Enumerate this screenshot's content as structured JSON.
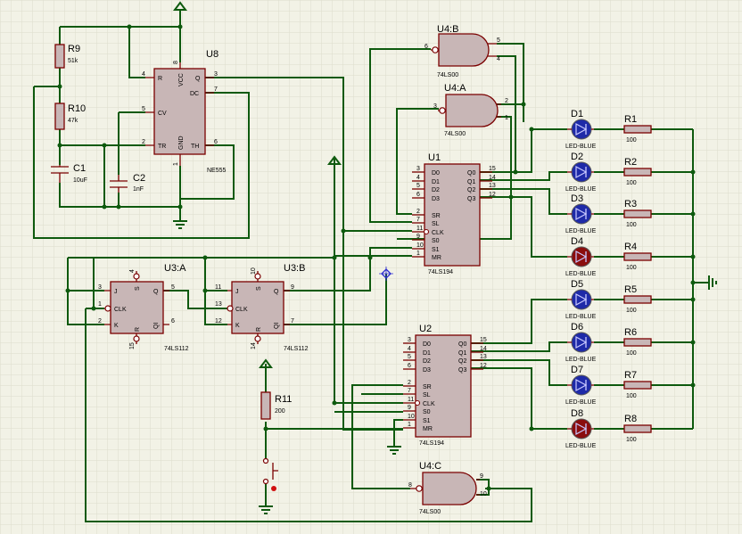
{
  "schematic": {
    "u8": {
      "ref": "U8",
      "type": "NE555",
      "pins": {
        "R": "R",
        "VCC": "VCC",
        "DC": "DC",
        "CV": "CV",
        "TR": "TR",
        "GND": "GND",
        "TH": "TH",
        "Q": "Q"
      },
      "pin_numbers": {
        "r": "4",
        "vcc": "8",
        "q": "3",
        "dc": "7",
        "cv": "5",
        "tr": "2",
        "gnd": "1",
        "th": "6"
      }
    },
    "r9": {
      "ref": "R9",
      "value": "51k"
    },
    "r10": {
      "ref": "R10",
      "value": "47k"
    },
    "c1": {
      "ref": "C1",
      "value": "10uF"
    },
    "c2": {
      "ref": "C2",
      "value": "1nF"
    },
    "u4b": {
      "ref": "U4:B",
      "type": "74LS00",
      "in1": "6",
      "in2": "5",
      "in3": "4"
    },
    "u4a": {
      "ref": "U4:A",
      "type": "74LS00",
      "out": "3",
      "in1": "2",
      "in2": "1"
    },
    "u4c": {
      "ref": "U4:C",
      "type": "74LS00",
      "out": "8",
      "in1": "9",
      "in2": "10"
    },
    "u1": {
      "ref": "U1",
      "type": "74LS194",
      "left": [
        {
          "n": "3",
          "l": "D0"
        },
        {
          "n": "4",
          "l": "D1"
        },
        {
          "n": "5",
          "l": "D2"
        },
        {
          "n": "6",
          "l": "D3"
        },
        {
          "n": "2",
          "l": "SR"
        },
        {
          "n": "7",
          "l": "SL"
        },
        {
          "n": "11",
          "l": "CLK"
        },
        {
          "n": "9",
          "l": "S0"
        },
        {
          "n": "10",
          "l": "S1"
        },
        {
          "n": "1",
          "l": "MR"
        }
      ],
      "right": [
        {
          "n": "15",
          "l": "Q0"
        },
        {
          "n": "14",
          "l": "Q1"
        },
        {
          "n": "13",
          "l": "Q2"
        },
        {
          "n": "12",
          "l": "Q3"
        }
      ]
    },
    "u2": {
      "ref": "U2",
      "type": "74LS194",
      "left": [
        {
          "n": "3",
          "l": "D0"
        },
        {
          "n": "4",
          "l": "D1"
        },
        {
          "n": "5",
          "l": "D2"
        },
        {
          "n": "6",
          "l": "D3"
        },
        {
          "n": "2",
          "l": "SR"
        },
        {
          "n": "7",
          "l": "SL"
        },
        {
          "n": "11",
          "l": "CLK"
        },
        {
          "n": "9",
          "l": "S0"
        },
        {
          "n": "10",
          "l": "S1"
        },
        {
          "n": "1",
          "l": "MR"
        }
      ],
      "right": [
        {
          "n": "15",
          "l": "Q0"
        },
        {
          "n": "14",
          "l": "Q1"
        },
        {
          "n": "13",
          "l": "Q2"
        },
        {
          "n": "12",
          "l": "Q3"
        }
      ]
    },
    "u3a": {
      "ref": "U3:A",
      "type": "74LS112",
      "pins": {
        "j": "3",
        "clk": "1",
        "k": "2",
        "q": "5",
        "qi": "6",
        "s": "4",
        "r": "15"
      },
      "labels": {
        "J": "J",
        "CLK": "CLK",
        "K": "K",
        "Q": "Q",
        "QI": "QI",
        "S": "S",
        "R": "R"
      }
    },
    "u3b": {
      "ref": "U3:B",
      "type": "74LS112",
      "pins": {
        "j": "11",
        "clk": "13",
        "k": "12",
        "q": "9",
        "qi": "7",
        "s": "10",
        "r": "14"
      },
      "labels": {
        "J": "J",
        "CLK": "CLK",
        "K": "K",
        "Q": "Q",
        "QI": "QI",
        "S": "S",
        "R": "R"
      }
    },
    "r11": {
      "ref": "R11",
      "value": "200"
    },
    "leds": [
      {
        "ref": "D1",
        "value": "LED-BLUE",
        "color": "#1e2aa8"
      },
      {
        "ref": "D2",
        "value": "LED-BLUE",
        "color": "#1e2aa8"
      },
      {
        "ref": "D3",
        "value": "LED-BLUE",
        "color": "#1e2aa8"
      },
      {
        "ref": "D4",
        "value": "LED-BLUE",
        "color": "#8a0d0d"
      },
      {
        "ref": "D5",
        "value": "LED-BLUE",
        "color": "#1e2aa8"
      },
      {
        "ref": "D6",
        "value": "LED-BLUE",
        "color": "#1e2aa8"
      },
      {
        "ref": "D7",
        "value": "LED-BLUE",
        "color": "#1e2aa8"
      },
      {
        "ref": "D8",
        "value": "LED-BLUE",
        "color": "#8a0d0d"
      }
    ],
    "resistors": [
      {
        "ref": "R1",
        "value": "100"
      },
      {
        "ref": "R2",
        "value": "100"
      },
      {
        "ref": "R3",
        "value": "100"
      },
      {
        "ref": "R4",
        "value": "100"
      },
      {
        "ref": "R5",
        "value": "100"
      },
      {
        "ref": "R6",
        "value": "100"
      },
      {
        "ref": "R7",
        "value": "100"
      },
      {
        "ref": "R8",
        "value": "100"
      }
    ],
    "colors": {
      "background": "#f2f2e6",
      "grid": "#dcdccc",
      "wire": "#0e5a0e",
      "component": "#7a0000",
      "body_fill": "#c8b6b6",
      "led_on": "#1e2aa8",
      "led_off": "#8a0d0d"
    }
  }
}
